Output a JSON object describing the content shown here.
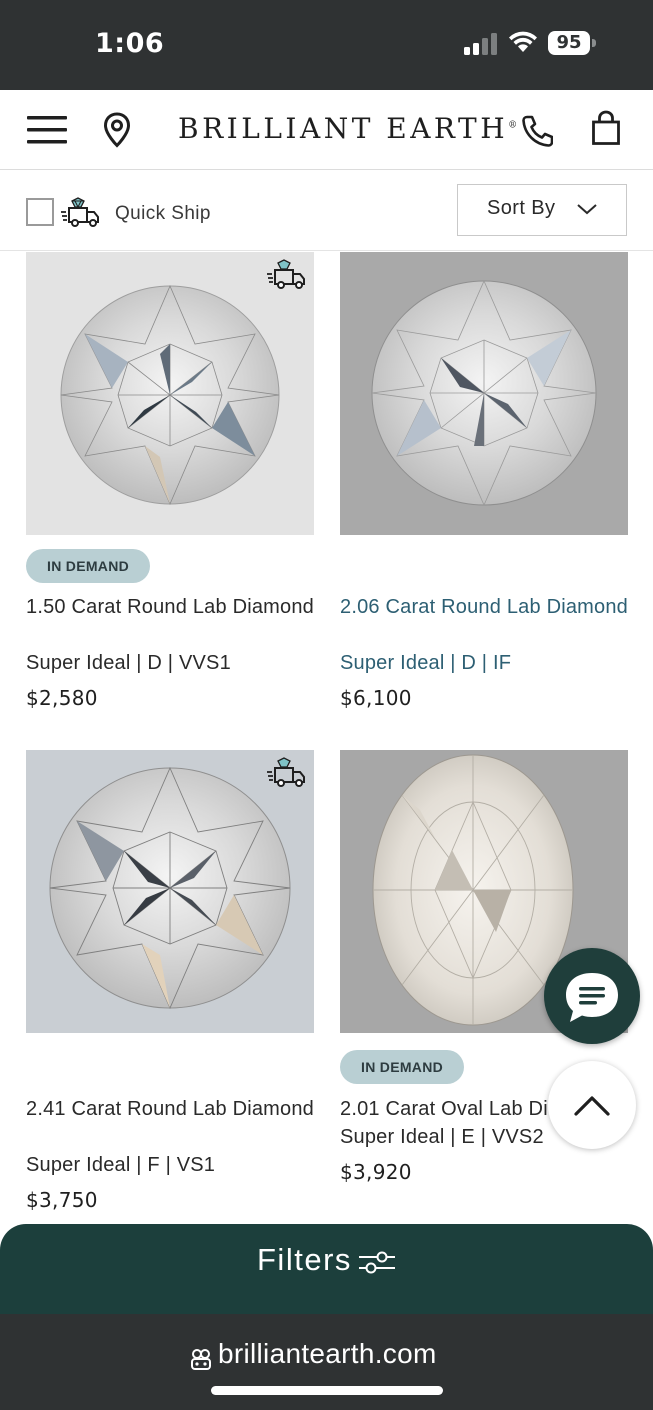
{
  "status_bar": {
    "time": "1:06",
    "battery": "95"
  },
  "header": {
    "brand": "BRILLIANT EARTH",
    "brand_mark": "®"
  },
  "toolbar": {
    "quick_ship_label": "Quick Ship",
    "sort_label": "Sort By"
  },
  "products": [
    {
      "badge": "IN DEMAND",
      "title": "1.50 Carat Round Lab Diamond",
      "specs": "Super Ideal | D | VVS1",
      "price": "$2,580",
      "quick_ship": true,
      "visited": false
    },
    {
      "badge": "",
      "title": "2.06 Carat Round Lab Diamond",
      "specs": "Super Ideal | D | IF",
      "price": "$6,100",
      "quick_ship": false,
      "visited": true
    },
    {
      "badge": "",
      "title": "2.41 Carat Round Lab Diamond",
      "specs": "Super Ideal | F | VS1",
      "price": "$3,750",
      "quick_ship": true,
      "visited": false
    },
    {
      "badge": "IN DEMAND",
      "title": "2.01 Carat Oval Lab Di",
      "specs": "Super Ideal | E | VVS2",
      "price": "$3,920",
      "quick_ship": false,
      "visited": false
    }
  ],
  "filters_bar": {
    "label": "Filters"
  },
  "browser": {
    "url": "brilliantearth.com"
  },
  "colors": {
    "brand_dark": "#1c3f3c",
    "badge_bg": "#b9cfd3",
    "link": "#2d5f73",
    "chrome": "#2f3233"
  }
}
